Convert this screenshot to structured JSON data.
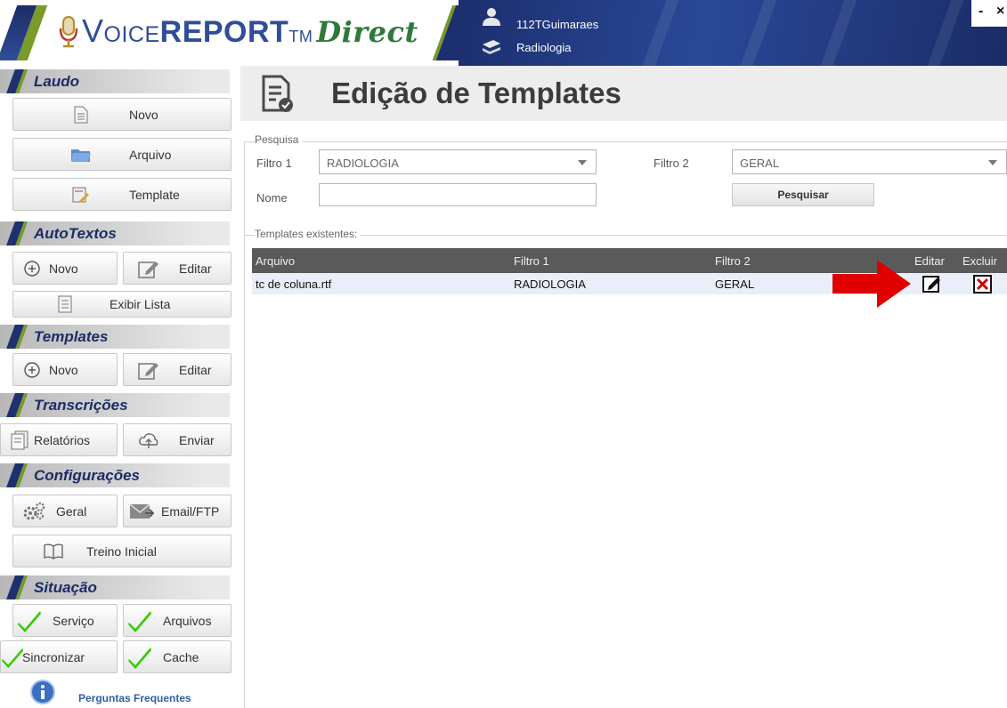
{
  "header": {
    "brand_voice": "Voice",
    "brand_report": "REPORT",
    "brand_tm": "TM",
    "brand_direct": "Direct",
    "user": "112TGuimaraes",
    "department": "Radiologia",
    "minimize": "-",
    "close": "×"
  },
  "sidebar": {
    "laudo": {
      "title": "Laudo",
      "novo": "Novo",
      "arquivo": "Arquivo",
      "template": "Template"
    },
    "autotextos": {
      "title": "AutoTextos",
      "novo": "Novo",
      "editar": "Editar",
      "exibir_lista": "Exibir Lista"
    },
    "templates": {
      "title": "Templates",
      "novo": "Novo",
      "editar": "Editar"
    },
    "transcricoes": {
      "title": "Transcrições",
      "relatorios": "Relatórios",
      "enviar": "Enviar"
    },
    "configuracoes": {
      "title": "Configurações",
      "geral": "Geral",
      "email_ftp": "Email/FTP",
      "treino_inicial": "Treino Inicial"
    },
    "situacao": {
      "title": "Situação",
      "servico": "Serviço",
      "arquivos": "Arquivos",
      "sincronizar": "Sincronizar",
      "cache": "Cache"
    },
    "faq": "Perguntas Frequentes"
  },
  "main": {
    "title": "Edição de Templates",
    "search": {
      "legend": "Pesquisa",
      "filtro1_label": "Filtro 1",
      "filtro1_value": "RADIOLOGIA",
      "filtro2_label": "Filtro 2",
      "filtro2_value": "GERAL",
      "nome_label": "Nome",
      "nome_value": "",
      "button": "Pesquisar"
    },
    "templates": {
      "legend": "Templates existentes:",
      "columns": [
        "Arquivo",
        "Filtro 1",
        "Filtro 2",
        "Editar",
        "Excluir"
      ],
      "rows": [
        {
          "arquivo": "tc de coluna.rtf",
          "filtro1": "RADIOLOGIA",
          "filtro2": "GERAL"
        }
      ]
    }
  },
  "colors": {
    "brand_blue": "#2f4d98",
    "brand_green": "#2d7a3a",
    "accent_green": "#7a9a2a",
    "status_ok": "#33cc00",
    "arrow_red": "#e00000"
  }
}
